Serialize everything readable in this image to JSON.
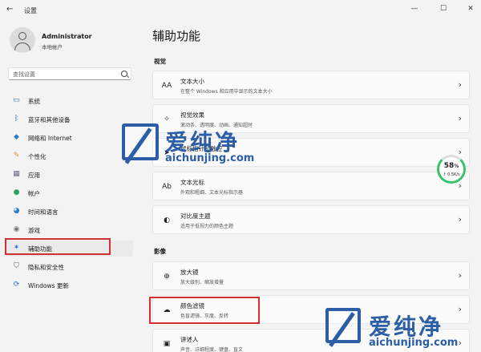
{
  "window": {
    "back_icon": "←",
    "title": "设置",
    "minimize": "—",
    "maximize": "☐",
    "close": "✕"
  },
  "user": {
    "name": "Administrator",
    "subtitle": "本地帐户"
  },
  "search": {
    "placeholder": "查找设置"
  },
  "sidebar": {
    "items": [
      {
        "label": "系统",
        "icon": "monitor-icon",
        "glyph": "▭",
        "color": "#2b6cb0"
      },
      {
        "label": "蓝牙和其他设备",
        "icon": "bluetooth-icon",
        "glyph": "ᛒ",
        "color": "#1e6fd9"
      },
      {
        "label": "网络和 Internet",
        "icon": "wifi-icon",
        "glyph": "◆",
        "color": "#2c7fc9"
      },
      {
        "label": "个性化",
        "icon": "brush-icon",
        "glyph": "✎",
        "color": "#d88a2a"
      },
      {
        "label": "应用",
        "icon": "apps-icon",
        "glyph": "▦",
        "color": "#6a6a8a"
      },
      {
        "label": "帐户",
        "icon": "account-icon",
        "glyph": "●",
        "color": "#2aa36b"
      },
      {
        "label": "时间和语言",
        "icon": "globe-clock-icon",
        "glyph": "◕",
        "color": "#2b7bd1"
      },
      {
        "label": "游戏",
        "icon": "gamepad-icon",
        "glyph": "◉",
        "color": "#777777"
      },
      {
        "label": "辅助功能",
        "icon": "accessibility-icon",
        "glyph": "✶",
        "color": "#1d6fd8"
      },
      {
        "label": "隐私和安全性",
        "icon": "shield-icon",
        "glyph": "⛉",
        "color": "#555555"
      },
      {
        "label": "Windows 更新",
        "icon": "update-icon",
        "glyph": "⟳",
        "color": "#1d6fd8"
      }
    ],
    "active_index": 8
  },
  "main": {
    "title": "辅助功能",
    "sections": [
      {
        "label": "视觉"
      },
      {
        "label": "影像"
      }
    ],
    "cards": [
      {
        "title": "文本大小",
        "subtitle": "在整个 Windows 和应用中显示的文本大小",
        "icon": "text-size-icon",
        "glyph": "AA"
      },
      {
        "title": "视觉效果",
        "subtitle": "滚动条、透明度、动画、通知超时",
        "icon": "sparkle-icon",
        "glyph": "✧"
      },
      {
        "title": "鼠标指针和触控",
        "subtitle": "",
        "icon": "pointer-icon",
        "glyph": "➤"
      },
      {
        "title": "文本光标",
        "subtitle": "外观和粗细、文本光标指示器",
        "icon": "text-cursor-icon",
        "glyph": "Ab"
      },
      {
        "title": "对比度主题",
        "subtitle": "适用于低视力的颜色主题",
        "icon": "contrast-icon",
        "glyph": "◐"
      },
      {
        "title": "放大镜",
        "subtitle": "放大级别、缩放增量",
        "icon": "magnifier-icon",
        "glyph": "⊕"
      },
      {
        "title": "颜色滤镜",
        "subtitle": "色盲滤镜、灰度、反转",
        "icon": "color-filter-icon",
        "glyph": "☁"
      },
      {
        "title": "讲述人",
        "subtitle": "声音、详细程度、键盘、盲文",
        "icon": "narrator-icon",
        "glyph": "▣"
      }
    ],
    "chevron": "›"
  },
  "gauge": {
    "value": "58",
    "unit": "%",
    "rate": "↑ 0.5K/s"
  },
  "watermark": {
    "brand": "爱纯净",
    "url": "aichunjing.com"
  }
}
